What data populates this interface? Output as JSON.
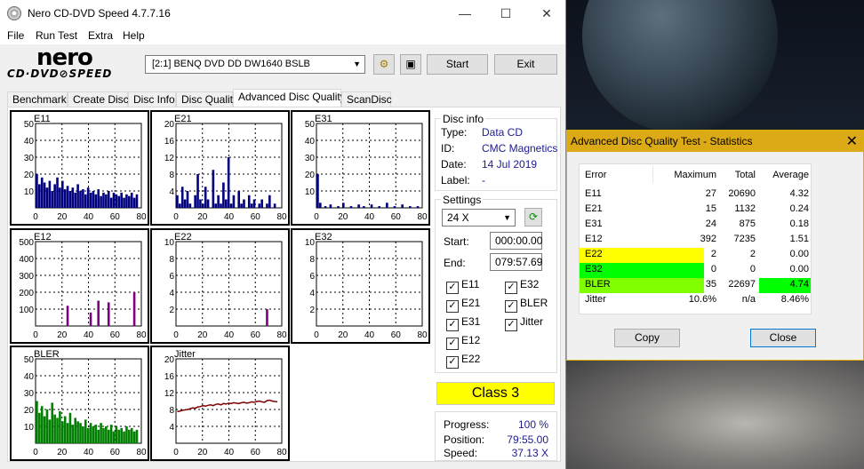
{
  "main_window": {
    "title": "Nero CD-DVD Speed 4.7.7.16",
    "minimize": "—",
    "maximize": "☐",
    "close": "✕"
  },
  "menu": [
    "File",
    "Run Test",
    "Extra",
    "Help"
  ],
  "logo": {
    "top": "nero",
    "bottom": "CD·DVD⊘SPEED"
  },
  "toolbar": {
    "drive": "[2:1]   BENQ DVD DD DW1640 BSLB",
    "start": "Start",
    "exit": "Exit"
  },
  "tabs": [
    "Benchmark",
    "Create Disc",
    "Disc Info",
    "Disc Quality",
    "Advanced Disc Quality",
    "ScanDisc"
  ],
  "active_tab": "Advanced Disc Quality",
  "graphs": [
    {
      "name": "E11",
      "ymax": 50,
      "yticks": [
        50,
        40,
        30,
        20,
        10
      ],
      "color": "#00007f",
      "kind": "bars",
      "values": [
        20,
        14,
        18,
        15,
        12,
        16,
        10,
        14,
        18,
        12,
        16,
        11,
        13,
        10,
        12,
        9,
        14,
        10,
        11,
        8,
        12,
        9,
        10,
        8,
        11,
        7,
        9,
        8,
        10,
        6,
        9,
        8,
        7,
        9,
        6,
        8,
        7,
        9,
        6,
        8
      ]
    },
    {
      "name": "E21",
      "ymax": 20,
      "yticks": [
        20,
        16,
        12,
        8,
        4
      ],
      "color": "#00007f",
      "kind": "bars",
      "values": [
        3,
        1,
        5,
        2,
        4,
        1,
        0,
        3,
        8,
        2,
        1,
        5,
        2,
        0,
        9,
        1,
        3,
        1,
        6,
        2,
        12,
        1,
        3,
        0,
        4,
        1,
        2,
        0,
        3,
        1,
        2,
        0,
        1,
        2,
        0,
        1,
        3,
        0,
        1,
        0
      ]
    },
    {
      "name": "E31",
      "ymax": 50,
      "yticks": [
        50,
        40,
        30,
        20,
        10
      ],
      "color": "#00007f",
      "kind": "bars",
      "values": [
        20,
        3,
        0,
        1,
        0,
        2,
        0,
        0,
        1,
        0,
        3,
        0,
        0,
        1,
        0,
        0,
        2,
        0,
        1,
        0,
        0,
        2,
        0,
        0,
        1,
        0,
        0,
        3,
        0,
        0,
        1,
        0,
        0,
        2,
        0,
        0,
        1,
        0,
        0,
        1
      ]
    },
    {
      "name": "E12",
      "ymax": 500,
      "yticks": [
        500,
        400,
        300,
        200,
        100
      ],
      "color": "#7f007f",
      "kind": "bars",
      "values": [
        0,
        0,
        0,
        0,
        0,
        0,
        0,
        0,
        0,
        0,
        0,
        0,
        120,
        0,
        0,
        0,
        0,
        0,
        0,
        0,
        0,
        80,
        0,
        0,
        150,
        0,
        0,
        0,
        140,
        0,
        0,
        0,
        0,
        0,
        0,
        0,
        0,
        0,
        200,
        0
      ]
    },
    {
      "name": "E22",
      "ymax": 10,
      "yticks": [
        10,
        8,
        6,
        4,
        2
      ],
      "color": "#7f007f",
      "kind": "bars",
      "values": [
        0,
        0,
        0,
        0,
        0,
        0,
        0,
        0,
        0,
        0,
        0,
        0,
        0,
        0,
        0,
        0,
        0,
        0,
        0,
        0,
        0,
        0,
        0,
        0,
        0,
        0,
        0,
        0,
        0,
        0,
        0,
        0,
        0,
        0,
        0,
        2,
        0,
        0,
        0,
        0
      ]
    },
    {
      "name": "E32",
      "ymax": 10,
      "yticks": [
        10,
        8,
        6,
        4,
        2
      ],
      "color": "#7f007f",
      "kind": "bars",
      "values": [
        0,
        0,
        0,
        0,
        0,
        0,
        0,
        0,
        0,
        0,
        0,
        0,
        0,
        0,
        0,
        0,
        0,
        0,
        0,
        0,
        0,
        0,
        0,
        0,
        0,
        0,
        0,
        0,
        0,
        0,
        0,
        0,
        0,
        0,
        0,
        0,
        0,
        0,
        0,
        0
      ]
    },
    {
      "name": "BLER",
      "ymax": 50,
      "yticks": [
        50,
        40,
        30,
        20,
        10
      ],
      "color": "#007f00",
      "kind": "bars",
      "values": [
        25,
        18,
        22,
        16,
        20,
        14,
        24,
        17,
        15,
        19,
        13,
        16,
        12,
        18,
        11,
        15,
        13,
        12,
        10,
        14,
        9,
        12,
        10,
        11,
        8,
        12,
        9,
        10,
        8,
        11,
        7,
        10,
        8,
        9,
        7,
        10,
        8,
        9,
        7,
        8
      ]
    },
    {
      "name": "Jitter",
      "ymax": 20,
      "yticks": [
        20,
        16,
        12,
        8,
        4
      ],
      "color": "#7f0000",
      "kind": "line",
      "values": [
        7.5,
        7.6,
        7.8,
        7.9,
        8.0,
        8.2,
        8.4,
        8.3,
        8.6,
        8.7,
        8.9,
        8.8,
        9.0,
        9.1,
        8.9,
        9.2,
        9.3,
        9.1,
        9.4,
        9.3,
        9.5,
        9.4,
        9.6,
        9.5,
        9.4,
        9.6,
        9.7,
        9.5,
        9.6,
        9.8,
        9.7,
        9.9,
        10.0,
        9.8,
        9.7,
        10.1,
        10.2,
        10.0,
        9.9,
        9.8
      ]
    }
  ],
  "xticks": [
    "0",
    "20",
    "40",
    "60",
    "80"
  ],
  "disc_info": {
    "title": "Disc info",
    "type_label": "Type:",
    "type_value": "Data CD",
    "id_label": "ID:",
    "id_value": "CMC Magnetics",
    "date_label": "Date:",
    "date_value": "14 Jul 2019",
    "label_label": "Label:",
    "label_value": "-"
  },
  "settings": {
    "title": "Settings",
    "speed": "24 X",
    "start_label": "Start:",
    "start_value": "000:00.00",
    "end_label": "End:",
    "end_value": "079:57.69"
  },
  "checks": [
    {
      "label": "E11",
      "checked": "✓"
    },
    {
      "label": "E32",
      "checked": "✓"
    },
    {
      "label": "E21",
      "checked": "✓"
    },
    {
      "label": "BLER",
      "checked": "✓"
    },
    {
      "label": "E31",
      "checked": "✓"
    },
    {
      "label": "Jitter",
      "checked": "✓"
    },
    {
      "label": "E12",
      "checked": "✓"
    },
    {
      "label": "E22",
      "checked": "✓"
    }
  ],
  "class_result": "Class 3",
  "progress": {
    "progress_label": "Progress:",
    "progress_value": "100 %",
    "position_label": "Position:",
    "position_value": "79:55.00",
    "speed_label": "Speed:",
    "speed_value": "37.13 X"
  },
  "stats_window": {
    "title": "Advanced Disc Quality Test - Statistics",
    "close": "✕",
    "headers": [
      "Error",
      "Maximum",
      "Total",
      "Average"
    ],
    "rows": [
      {
        "error": "E11",
        "maximum": "27",
        "total": "20690",
        "average": "4.32",
        "hl_max": "",
        "hl_avg": ""
      },
      {
        "error": "E21",
        "maximum": "15",
        "total": "1132",
        "average": "0.24",
        "hl_max": "",
        "hl_avg": ""
      },
      {
        "error": "E31",
        "maximum": "24",
        "total": "875",
        "average": "0.18",
        "hl_max": "",
        "hl_avg": ""
      },
      {
        "error": "E12",
        "maximum": "392",
        "total": "7235",
        "average": "1.51",
        "hl_max": "",
        "hl_avg": ""
      },
      {
        "error": "E22",
        "maximum": "2",
        "total": "2",
        "average": "0.00",
        "hl_max": "#ffff00",
        "hl_avg": ""
      },
      {
        "error": "E32",
        "maximum": "0",
        "total": "0",
        "average": "0.00",
        "hl_max": "#00ff00",
        "hl_avg": ""
      },
      {
        "error": "BLER",
        "maximum": "35",
        "total": "22697",
        "average": "4.74",
        "hl_max": "#7fff00",
        "hl_avg": "#00ff00"
      },
      {
        "error": "Jitter",
        "maximum": "10.6%",
        "total": "n/a",
        "average": "8.46%",
        "hl_max": "",
        "hl_avg": ""
      }
    ],
    "copy": "Copy",
    "close_button": "Close"
  }
}
